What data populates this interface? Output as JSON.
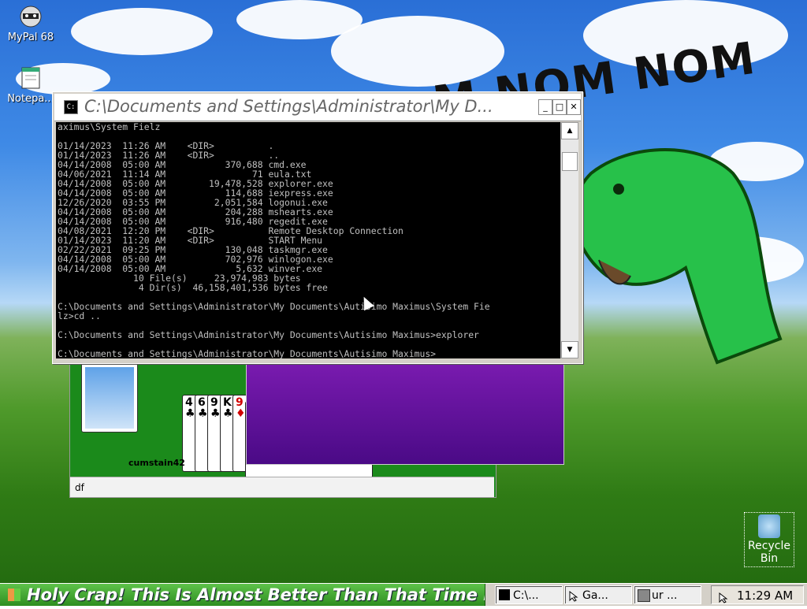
{
  "desktop": {
    "icons": [
      {
        "label": "MyPal 68",
        "icon": "raccoon-icon"
      },
      {
        "label": "Notepa...",
        "icon": "notepad-icon"
      }
    ],
    "graffiti_text": "M NOM NOM",
    "recycle_bin": {
      "label": "Recycle Bin",
      "icon": "recycle-bin-icon"
    }
  },
  "console": {
    "title": "C:\\Documents and Settings\\Administrator\\My D...",
    "buttons": [
      "minimize",
      "maximize",
      "close"
    ],
    "lines": [
      "aximus\\System Fielz",
      "",
      "01/14/2023  11:26 AM    <DIR>          .",
      "01/14/2023  11:26 AM    <DIR>          ..",
      "04/14/2008  05:00 AM           370,688 cmd.exe",
      "04/06/2021  11:14 AM                71 eula.txt",
      "04/14/2008  05:00 AM        19,478,528 explorer.exe",
      "04/14/2008  05:00 AM           114,688 iexpress.exe",
      "12/26/2020  03:55 PM         2,051,584 logonui.exe",
      "04/14/2008  05:00 AM           204,288 mshearts.exe",
      "04/14/2008  05:00 AM           916,480 regedit.exe",
      "04/08/2021  12:20 PM    <DIR>          Remote Desktop Connection",
      "01/14/2023  11:20 AM    <DIR>          START Menu",
      "02/22/2021  09:25 PM           130,048 taskmgr.exe",
      "04/14/2008  05:00 AM           702,976 winlogon.exe",
      "04/14/2008  05:00 AM             5,632 winver.exe",
      "              10 File(s)     23,974,983 bytes",
      "               4 Dir(s)  46,158,401,536 bytes free",
      "",
      "C:\\Documents and Settings\\Administrator\\My Documents\\Autisimo Maximus\\System Fie",
      "lz>cd ..",
      "",
      "C:\\Documents and Settings\\Administrator\\My Documents\\Autisimo Maximus>explorer",
      "",
      "C:\\Documents and Settings\\Administrator\\My Documents\\Autisimo Maximus>"
    ]
  },
  "solitaire": {
    "username": "cumstain42",
    "status_text": "df",
    "cards": [
      {
        "rank": "4",
        "suit": "♣",
        "color": "#000000"
      },
      {
        "rank": "6",
        "suit": "♣",
        "color": "#000000"
      },
      {
        "rank": "9",
        "suit": "♣",
        "color": "#000000"
      },
      {
        "rank": "K",
        "suit": "♣",
        "color": "#000000"
      },
      {
        "rank": "9",
        "suit": "♦",
        "color": "#d00000"
      }
    ]
  },
  "taskbar": {
    "start_text": "Holy Crap! This Is Almost Better Than That Time I",
    "tasks": [
      {
        "label": "C:\\...",
        "icon": "console-icon"
      },
      {
        "label": "Ga...",
        "icon": "cursor-icon"
      },
      {
        "label": "ur ...",
        "icon": "app-icon"
      }
    ],
    "clock": "11:29 AM"
  },
  "colors": {
    "console_bg": "#000000",
    "console_text": "#c0c0c0",
    "felt": "#1b8a1b",
    "purple": "#6a14a0",
    "start_green": "#3a9a2a"
  }
}
